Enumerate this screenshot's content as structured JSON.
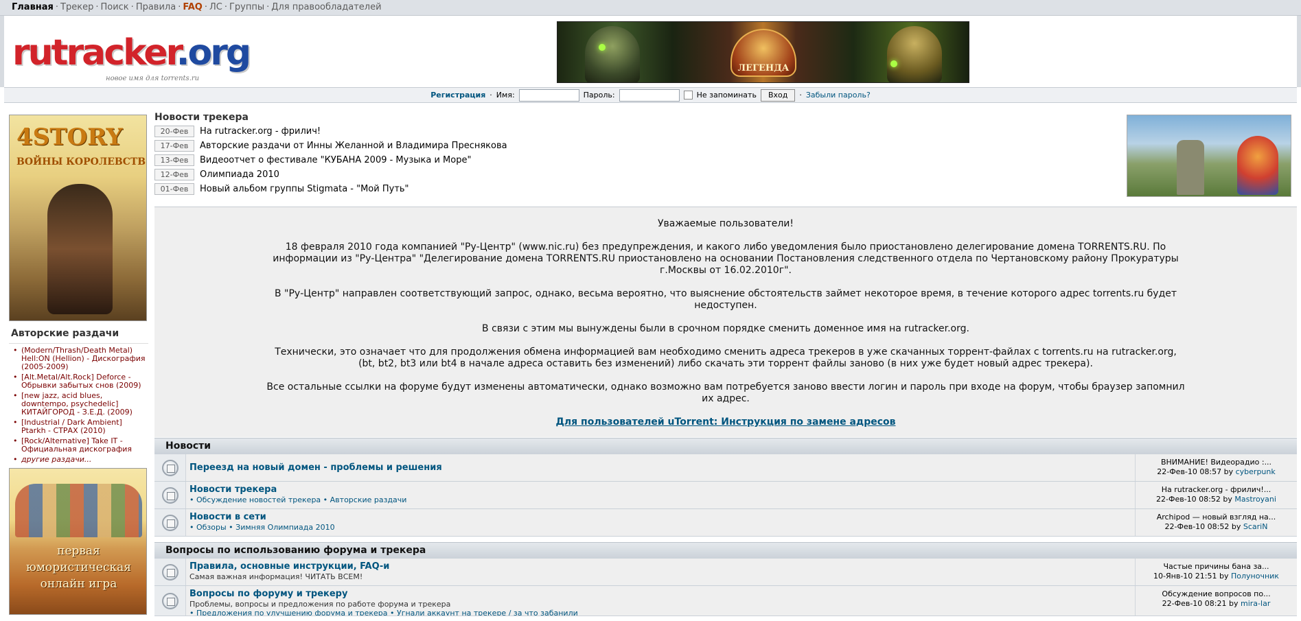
{
  "topnav": {
    "items": [
      "Главная",
      "Трекер",
      "Поиск",
      "Правила",
      "FAQ",
      "ЛС",
      "Группы",
      "Для правообладателей"
    ]
  },
  "logo": {
    "word_main": "rutracker",
    "word_suffix": ".org",
    "tagline": "новое имя для torrents.ru"
  },
  "banner_top": {
    "text": "ЛЕГЕНДА"
  },
  "login": {
    "register": "Регистрация",
    "name_label": "Имя:",
    "password_label": "Пароль:",
    "remember_label": "Не запоминать",
    "submit_label": "Вход",
    "forgot_label": "Забыли пароль?"
  },
  "left": {
    "ad1": {
      "title": "4STORY",
      "subtitle": "ВОЙНЫ КОРОЛЕВСТВ"
    },
    "authored_title": "Авторские раздачи",
    "authored": [
      "(Modern/Thrash/Death Metal) Hell:ON (Hellion) - Дискография (2005-2009)",
      "[Alt.Metal/Alt.Rock] Deforce - Обрывки забытых снов (2009)",
      "[new jazz, acid blues, downtempo, psychedelic] КИТАЙГОРОД - З.Е.Д. (2009)",
      "[Industrial / Dark Ambient] Ptarkh - СТРАХ (2010)",
      "[Rock/Alternative] Take IT - Официальная дискография"
    ],
    "authored_more": "другие раздачи...",
    "ad2": {
      "text_line1": "первая",
      "text_line2": "юмористическая",
      "text_line3": "онлайн игра"
    }
  },
  "news": {
    "title": "Новости трекера",
    "items": [
      {
        "date": "20-Фев",
        "text": "На rutracker.org - фрилич!"
      },
      {
        "date": "17-Фев",
        "text": "Авторские раздачи от Инны Желанной и Владимира Преснякова"
      },
      {
        "date": "13-Фев",
        "text": "Видеоотчет о фестивале \"КУБАНА 2009 - Музыка и Море\""
      },
      {
        "date": "12-Фев",
        "text": "Олимпиада 2010"
      },
      {
        "date": "01-Фев",
        "text": "Новый альбом группы Stigmata - \"Мой Путь\""
      }
    ]
  },
  "announce": {
    "greeting": "Уважаемые пользователи!",
    "p1": "18 февраля 2010 года компанией \"Ру-Центр\" (www.nic.ru) без предупреждения, и какого либо уведомления было приостановлено делегирование домена TORRENTS.RU. По информации из \"Ру-Центра\" \"Делегирование домена TORRENTS.RU приостановлено на основании Постановления следственного отдела по Чертановскому району Прокуратуры г.Москвы от 16.02.2010г\".",
    "p2": "В \"Ру-Центр\" направлен соответствующий запрос, однако, весьма вероятно, что выяснение обстоятельств займет некоторое время, в течение которого адрес torrents.ru будет недоступен.",
    "p3": "В связи с этим мы вынуждены были в срочном порядке сменить доменное имя на rutracker.org.",
    "p4": "Технически, это означает что для продолжения обмена информацией вам необходимо сменить адреса трекеров в уже скачанных торрент-файлах с torrents.ru на rutracker.org, (bt, bt2, bt3 или bt4 в начале адреса оставить без изменений) либо скачать эти торрент файлы заново (в них уже будет новый адрес трекера).",
    "p5": "Все остальные ссылки на форуме будут изменены автоматически, однако возможно вам потребуется заново ввести логин и пароль при входе на форум, чтобы браузер запомнил их адрес.",
    "link": "Для пользователей uTorrent: Инструкция по замене адресов"
  },
  "categories": [
    {
      "title": "Новости",
      "forums": [
        {
          "name": "Переезд на новый домен - проблемы и решения",
          "desc": "",
          "sub": "",
          "last_title": "ВНИМАНИЕ! Видеорадио :...",
          "last_meta": "22-Фев-10 08:57",
          "last_user": "cyberpunk"
        },
        {
          "name": "Новости трекера",
          "desc": "",
          "sub": "• Обсуждение новостей трекера • Авторские раздачи",
          "last_title": "На rutracker.org - фрилич!...",
          "last_meta": "22-Фев-10 08:52",
          "last_user": "Mastroyani"
        },
        {
          "name": "Новости в сети",
          "desc": "",
          "sub": "• Обзоры • Зимняя Олимпиада 2010",
          "last_title": "Archipod — новый взгляд на...",
          "last_meta": "22-Фев-10 08:52",
          "last_user": "ScariN"
        }
      ]
    },
    {
      "title": "Вопросы по использованию форума и трекера",
      "forums": [
        {
          "name": "Правила, основные инструкции, FAQ-и",
          "desc": "Самая важная информация! ЧИТАТЬ ВСЕМ!",
          "sub": "",
          "last_title": "Частые причины бана за...",
          "last_meta": "10-Янв-10 21:51",
          "last_user": "Полуночник"
        },
        {
          "name": "Вопросы по форуму и трекеру",
          "desc": "Проблемы, вопросы и предложения по работе форума и трекера",
          "sub": "• Предложения по улучшению форума и трекера • Угнали аккаунт на трекере / за что забанили",
          "last_title": "Обсуждение вопросов по...",
          "last_meta": "22-Фев-10 08:21",
          "last_user": "mira-lar"
        }
      ]
    }
  ],
  "by_label": "by"
}
